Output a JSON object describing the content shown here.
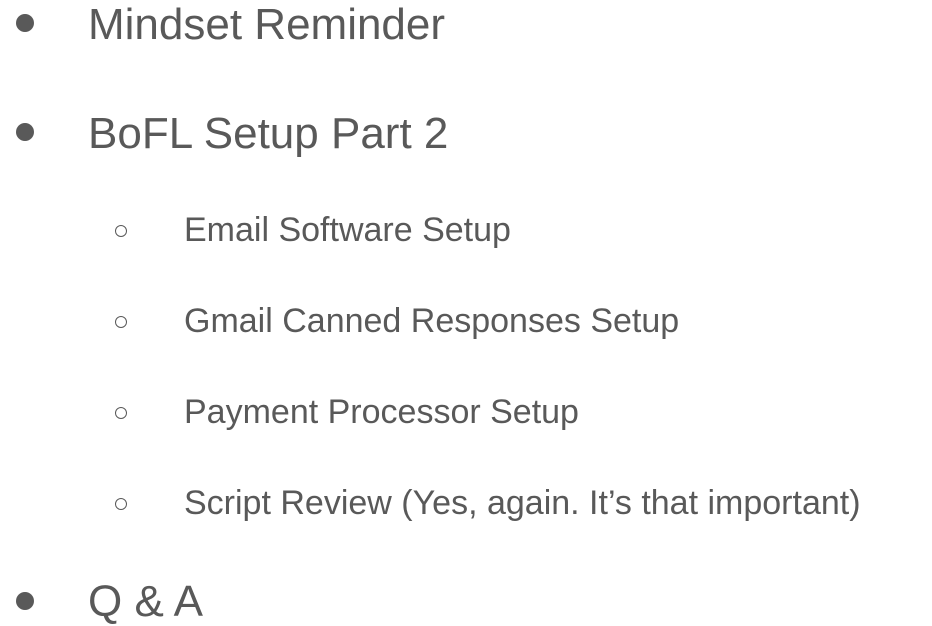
{
  "items": [
    {
      "level": 1,
      "label": "Mindset Reminder",
      "bullet_icon": "filled-circle-bullet"
    },
    {
      "level": 1,
      "label": "BoFL Setup Part 2",
      "bullet_icon": "filled-circle-bullet",
      "children": [
        {
          "level": 2,
          "label": "Email Software Setup",
          "bullet_icon": "hollow-circle-bullet"
        },
        {
          "level": 2,
          "label": "Gmail Canned Responses Setup",
          "bullet_icon": "hollow-circle-bullet"
        },
        {
          "level": 2,
          "label": "Payment Processor Setup",
          "bullet_icon": "hollow-circle-bullet"
        },
        {
          "level": 2,
          "label": "Script Review (Yes, again. It’s that important)",
          "bullet_icon": "hollow-circle-bullet"
        }
      ]
    },
    {
      "level": 1,
      "label": "Q & A",
      "bullet_icon": "filled-circle-bullet"
    }
  ],
  "colors": {
    "text": "#595959",
    "background": "#ffffff"
  }
}
